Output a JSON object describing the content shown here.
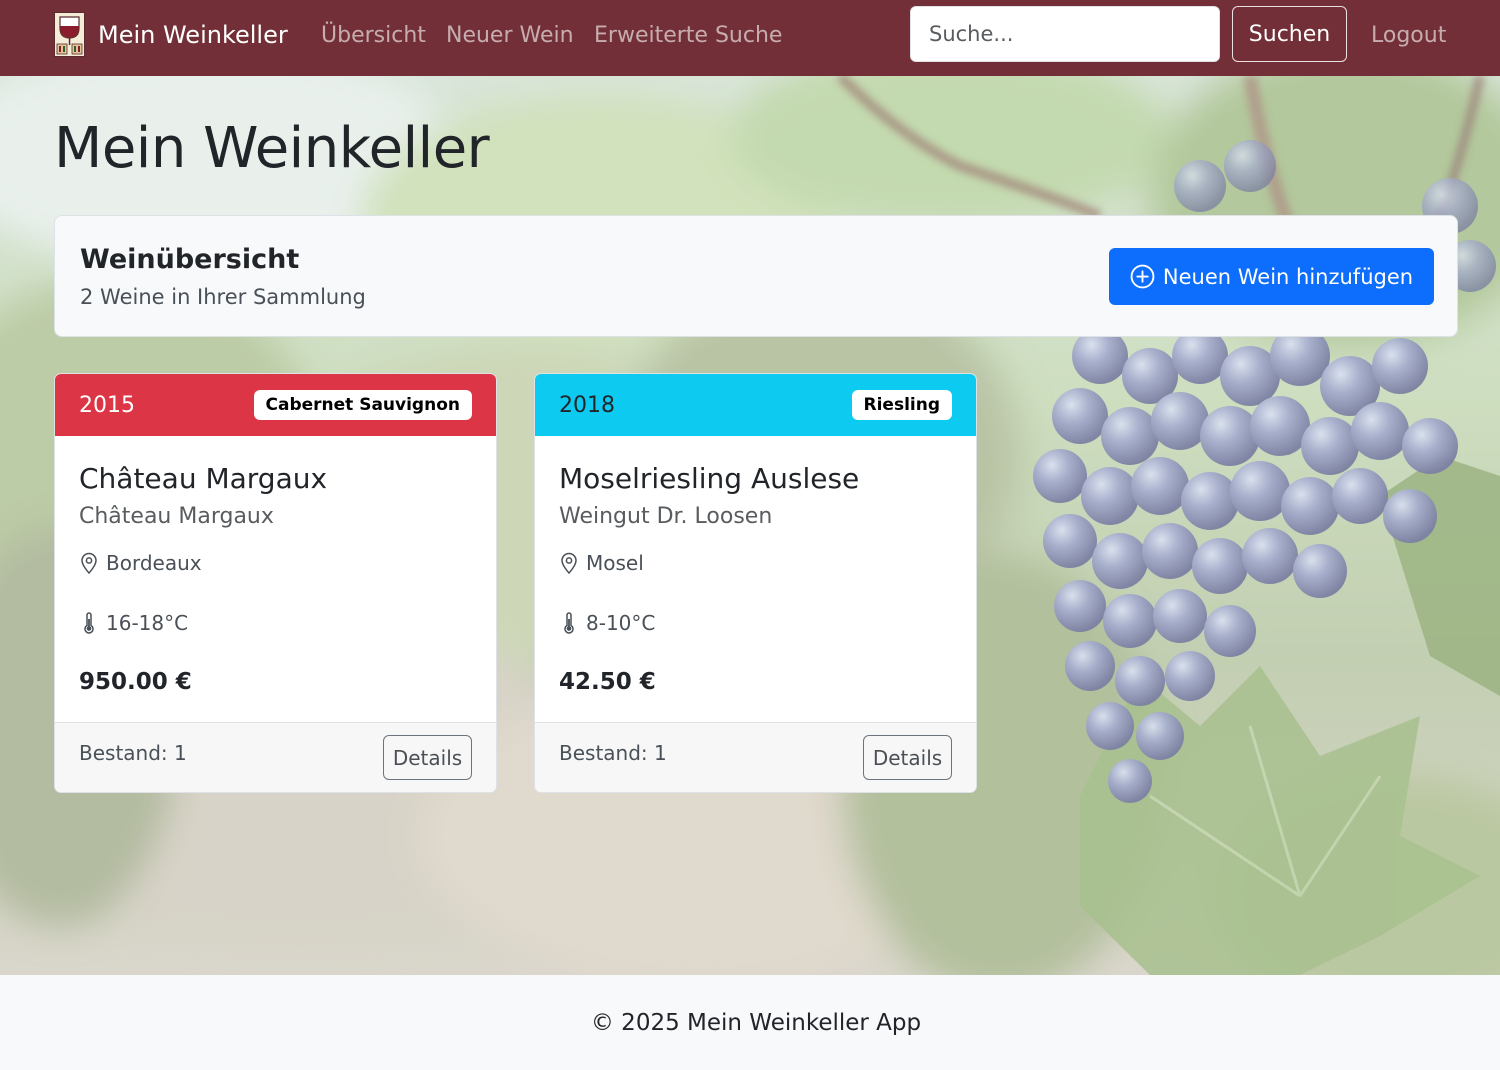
{
  "navbar": {
    "brand": "Mein Weinkeller",
    "links": [
      "Übersicht",
      "Neuer Wein",
      "Erweiterte Suche"
    ],
    "search_placeholder": "Suche...",
    "search_button": "Suchen",
    "logout": "Logout",
    "bg_color": "#722f37"
  },
  "page_title": "Mein Weinkeller",
  "overview": {
    "title": "Weinübersicht",
    "subtitle": "2 Weine in Ihrer Sammlung",
    "add_button": "Neuen Wein hinzufügen",
    "add_button_icon": "plus-circle-icon"
  },
  "wines": [
    {
      "year": "2015",
      "grape": "Cabernet Sauvignon",
      "name": "Château Margaux",
      "winery": "Château Margaux",
      "region": "Bordeaux",
      "temperature": "16-18°C",
      "price": "950.00 €",
      "stock": "Bestand: 1",
      "details": "Details",
      "header_color": "#dc3545",
      "header_text_color": "#ffffff"
    },
    {
      "year": "2018",
      "grape": "Riesling",
      "name": "Moselriesling Auslese",
      "winery": "Weingut Dr. Loosen",
      "region": "Mosel",
      "temperature": "8-10°C",
      "price": "42.50 €",
      "stock": "Bestand: 1",
      "details": "Details",
      "header_color": "#0dcaf0",
      "header_text_color": "#212529"
    }
  ],
  "footer": "© 2025 Mein Weinkeller App"
}
